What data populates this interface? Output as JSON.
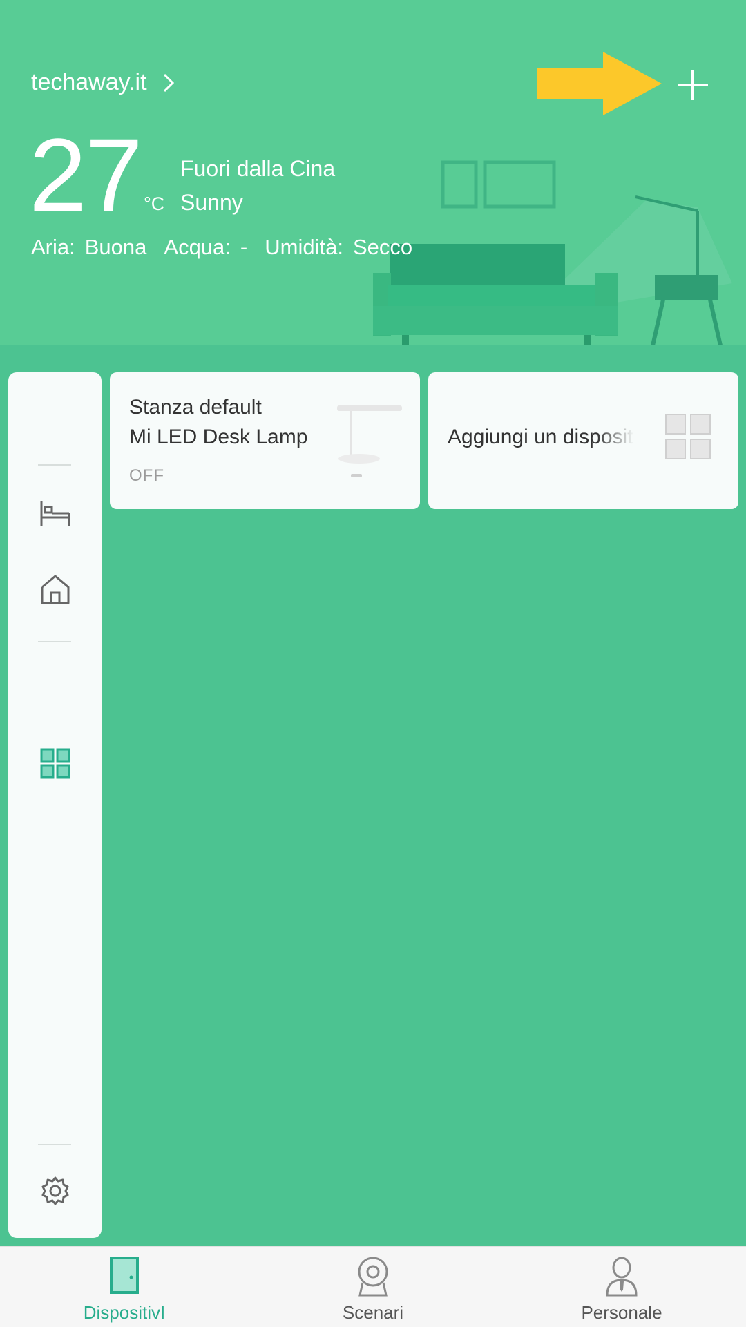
{
  "header": {
    "home_name": "techaway.it",
    "temperature": "27",
    "temperature_unit": "°C",
    "location": "Fuori dalla Cina",
    "weather": "Sunny",
    "stats": [
      {
        "label": "Aria:",
        "value": "Buona"
      },
      {
        "label": "Acqua:",
        "value": "-"
      },
      {
        "label": "Umidità:",
        "value": "Secco"
      }
    ],
    "add_icon": "plus-icon",
    "annotation_color": "#fcc82a"
  },
  "sidebar": {
    "items": [
      {
        "icon": "grid-icon",
        "active": true
      },
      {
        "icon": "bed-icon",
        "active": false
      },
      {
        "icon": "house-icon",
        "active": false
      },
      {
        "icon": "gear-icon",
        "active": false
      }
    ]
  },
  "devices": [
    {
      "room": "Stanza default",
      "name": "Mi LED Desk Lamp",
      "status": "OFF",
      "icon": "desk-lamp-image"
    },
    {
      "label": "Aggiungi un dispositivo",
      "icon": "add-device-grid-icon"
    }
  ],
  "tabbar": {
    "tabs": [
      {
        "label": "DispositivI",
        "icon": "door-icon",
        "active": true
      },
      {
        "label": "Scenari",
        "icon": "camera-icon",
        "active": false
      },
      {
        "label": "Personale",
        "icon": "person-icon",
        "active": false
      }
    ]
  },
  "colors": {
    "background": "#4cc391",
    "header": "#58cc95",
    "accent": "#27ad8c",
    "card": "#f7fbfa"
  }
}
